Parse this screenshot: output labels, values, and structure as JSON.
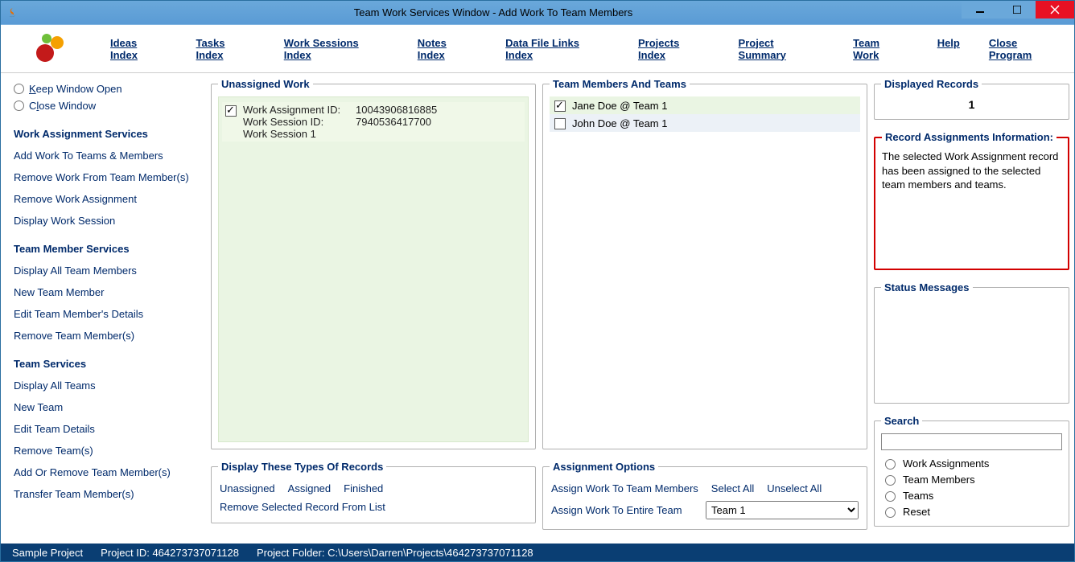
{
  "window": {
    "title": "Team Work Services Window - Add Work To Team Members"
  },
  "menu": {
    "ideas": "Ideas Index",
    "tasks": "Tasks Index",
    "sessions": "Work Sessions Index",
    "notes": "Notes Index",
    "datafile": "Data File Links Index",
    "projects": "Projects Index",
    "summary": "Project Summary",
    "teamwork": "Team Work",
    "help": "Help",
    "close": "Close Program"
  },
  "sidebar": {
    "keep_open": "Keep Window Open",
    "close_window": "Close Window",
    "sections": {
      "wa_title": "Work Assignment Services",
      "tm_title": "Team Member Services",
      "team_title": "Team Services"
    },
    "links": {
      "add_work": "Add Work To Teams & Members",
      "remove_work_member": "Remove Work From Team Member(s)",
      "remove_work_assignment": "Remove Work Assignment",
      "display_work_session": "Display Work Session",
      "display_all_members": "Display All Team Members",
      "new_member": "New Team Member",
      "edit_member": "Edit Team Member's Details",
      "remove_member": "Remove Team Member(s)",
      "display_all_teams": "Display All Teams",
      "new_team": "New Team",
      "edit_team": "Edit Team Details",
      "remove_team": "Remove Team(s)",
      "add_remove_member": "Add Or Remove Team Member(s)",
      "transfer_member": "Transfer Team Member(s)"
    }
  },
  "unassigned": {
    "legend": "Unassigned Work",
    "record": {
      "wa_id_label": "Work Assignment ID:",
      "wa_id_value": "10043906816885",
      "ws_id_label": "Work Session ID:",
      "ws_id_value": "7940536417700",
      "ws_name_label": "Work Session 1"
    },
    "filters_legend": "Display These Types Of Records",
    "filters": {
      "unassigned": "Unassigned",
      "assigned": "Assigned",
      "finished": "Finished",
      "remove_selected": "Remove Selected Record From List"
    }
  },
  "teams": {
    "legend": "Team Members And Teams",
    "members": [
      {
        "label": "Jane Doe @ Team 1",
        "checked": true
      },
      {
        "label": "John Doe @ Team 1",
        "checked": false
      }
    ],
    "options_legend": "Assignment Options",
    "options": {
      "assign_members": "Assign Work To Team Members",
      "select_all": "Select All",
      "unselect_all": "Unselect All",
      "assign_team": "Assign Work To Entire Team",
      "team_select_value": "Team 1"
    }
  },
  "right": {
    "displayed_legend": "Displayed Records",
    "displayed_count": "1",
    "info_legend": "Record Assignments Information:",
    "info_text": "The selected Work Assignment record has been assigned to the selected team members and teams.",
    "status_legend": "Status Messages",
    "search_legend": "Search",
    "search": {
      "work_assignments": "Work Assignments",
      "team_members": "Team Members",
      "teams": "Teams",
      "reset": "Reset"
    }
  },
  "statusbar": {
    "project_name": "Sample Project",
    "project_id": "Project ID:  464273737071128",
    "project_folder": "Project Folder: C:\\Users\\Darren\\Projects\\464273737071128"
  }
}
